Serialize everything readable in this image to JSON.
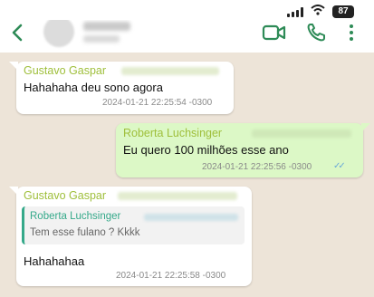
{
  "status_bar": {
    "battery": "87",
    "icons": [
      "signal-icon",
      "wifi-icon",
      "battery-icon"
    ]
  },
  "header": {
    "icons": [
      "back-chevron-icon",
      "video-call-icon",
      "phone-icon",
      "more-vert-icon"
    ],
    "accent_color": "#2e8b57"
  },
  "messages": [
    {
      "direction": "incoming",
      "sender": "Gustavo Gaspar",
      "text": "Hahahaha deu sono agora",
      "timestamp": "2024-01-21 22:25:54 -0300"
    },
    {
      "direction": "outgoing",
      "sender": "Roberta Luchsinger",
      "text": "Eu quero 100 milhões esse ano",
      "timestamp": "2024-01-21 22:25:56 -0300",
      "status_icon": "double-check-icon"
    },
    {
      "direction": "incoming",
      "sender": "Gustavo Gaspar",
      "quote": {
        "sender": "Roberta Luchsinger",
        "text": "Tem esse fulano ? Kkkk"
      },
      "text": "Hahahahaa",
      "timestamp": "2024-01-21 22:25:58 -0300"
    }
  ],
  "colors": {
    "background": "#ede4d8",
    "incoming_bubble": "#ffffff",
    "outgoing_bubble": "#dcf8c6",
    "sender_name": "#9fbf3b",
    "quote_accent": "#35a98a",
    "read_ticks": "#6aa9d8"
  }
}
